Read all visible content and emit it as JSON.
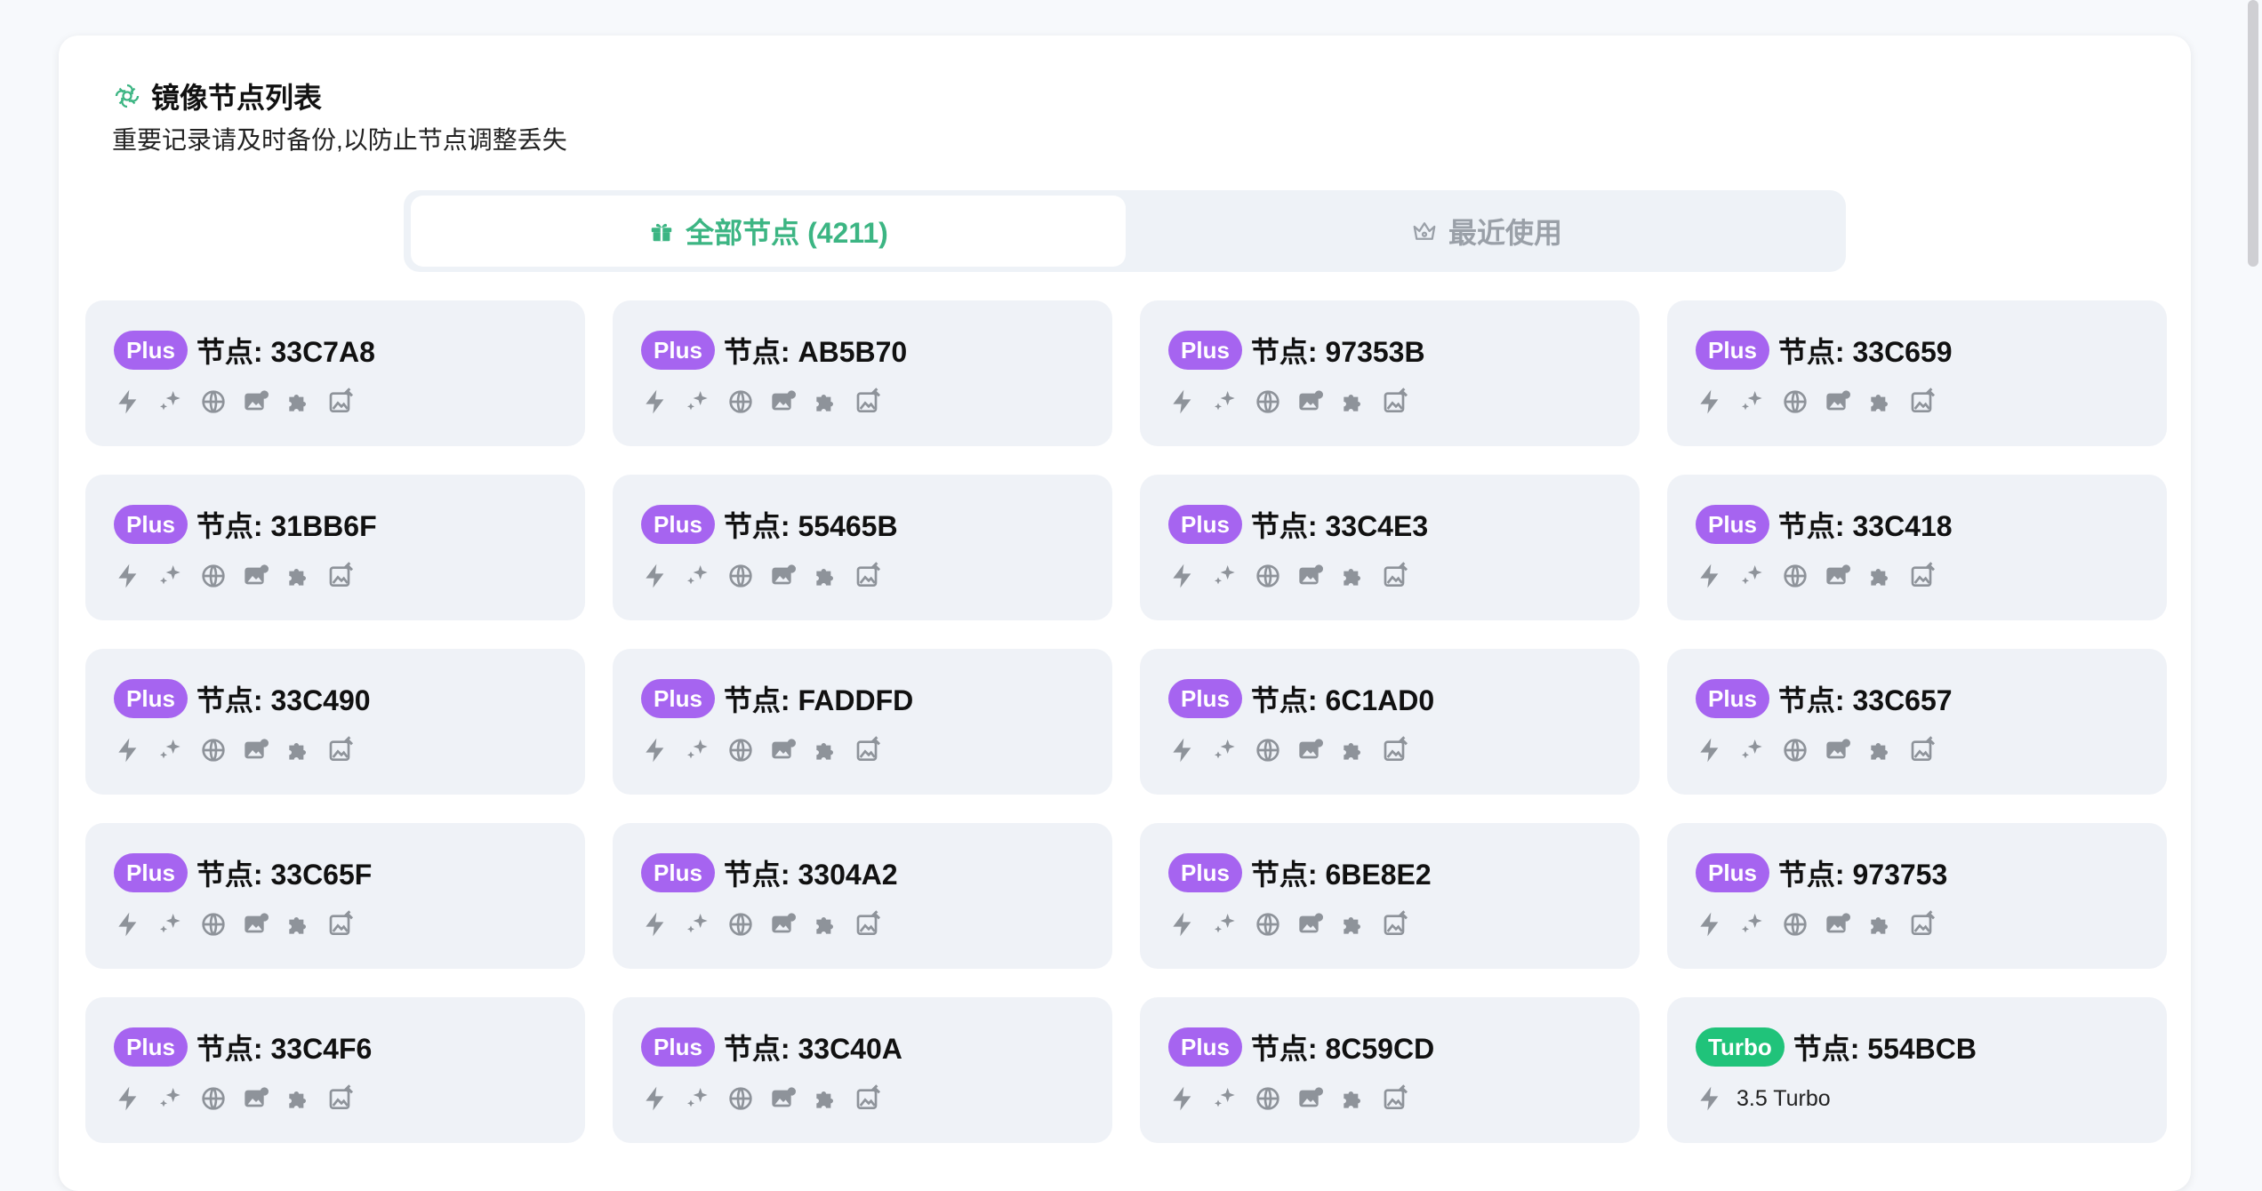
{
  "header": {
    "title": "镜像节点列表",
    "subtitle": "重要记录请及时备份,以防止节点调整丢失",
    "logo_icon": "openai-logo-icon"
  },
  "tabs": [
    {
      "label": "全部节点 (4211)",
      "icon": "gift-icon",
      "active": true
    },
    {
      "label": "最近使用",
      "icon": "crown-icon",
      "active": false
    }
  ],
  "colors": {
    "accent_green": "#3cb583",
    "plus_badge": "#a664f0",
    "turbo_badge": "#20c37a",
    "card_bg": "#eff2f7",
    "icon_gray": "#8e939a"
  },
  "feature_icons": [
    "bolt-icon",
    "sparkles-icon",
    "globe-icon",
    "image-chat-icon",
    "puzzle-icon",
    "image-edit-icon"
  ],
  "nodes": [
    {
      "badge": "Plus",
      "name": "节点: 33C7A8"
    },
    {
      "badge": "Plus",
      "name": "节点: AB5B70"
    },
    {
      "badge": "Plus",
      "name": "节点: 97353B"
    },
    {
      "badge": "Plus",
      "name": "节点: 33C659"
    },
    {
      "badge": "Plus",
      "name": "节点: 31BB6F"
    },
    {
      "badge": "Plus",
      "name": "节点: 55465B"
    },
    {
      "badge": "Plus",
      "name": "节点: 33C4E3"
    },
    {
      "badge": "Plus",
      "name": "节点: 33C418"
    },
    {
      "badge": "Plus",
      "name": "节点: 33C490"
    },
    {
      "badge": "Plus",
      "name": "节点: FADDFD"
    },
    {
      "badge": "Plus",
      "name": "节点: 6C1AD0"
    },
    {
      "badge": "Plus",
      "name": "节点: 33C657"
    },
    {
      "badge": "Plus",
      "name": "节点: 33C65F"
    },
    {
      "badge": "Plus",
      "name": "节点: 3304A2"
    },
    {
      "badge": "Plus",
      "name": "节点: 6BE8E2"
    },
    {
      "badge": "Plus",
      "name": "节点: 973753"
    },
    {
      "badge": "Plus",
      "name": "节点: 33C4F6"
    },
    {
      "badge": "Plus",
      "name": "节点: 33C40A"
    },
    {
      "badge": "Plus",
      "name": "节点: 8C59CD"
    },
    {
      "badge": "Turbo",
      "name": "节点: 554BCB",
      "feature_text": "3.5 Turbo"
    }
  ]
}
